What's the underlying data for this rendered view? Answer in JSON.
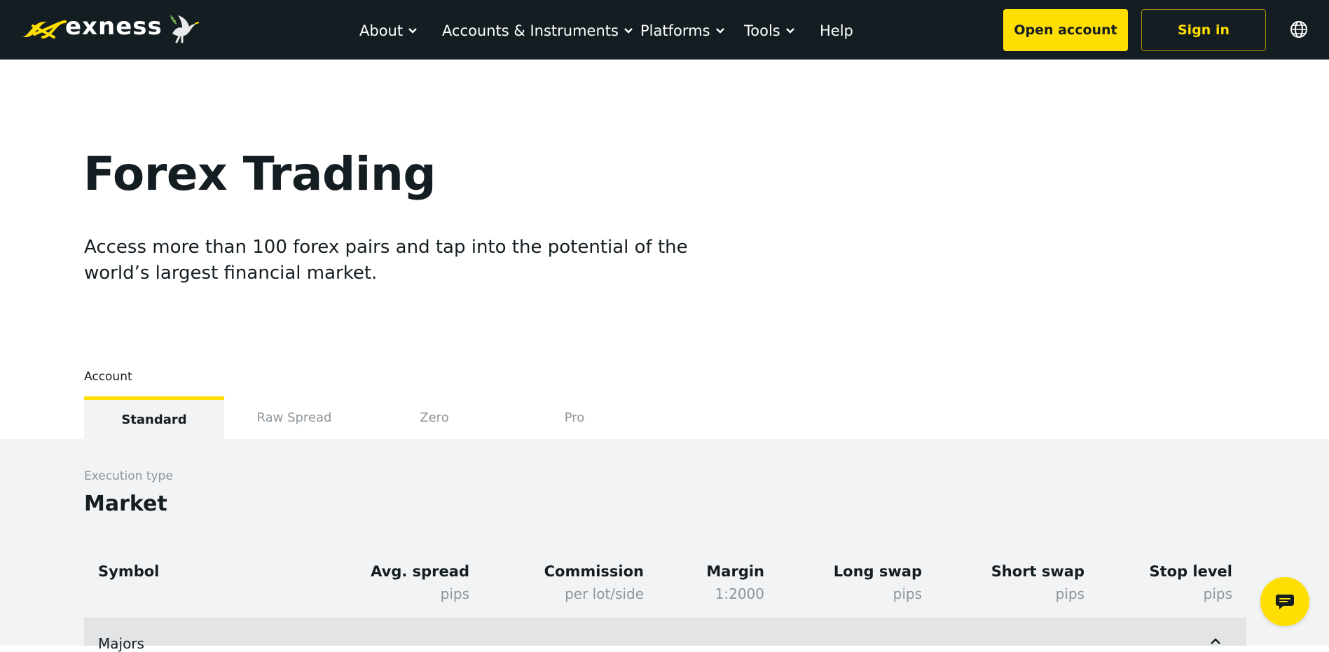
{
  "header": {
    "logo_text": "exness",
    "nav": [
      {
        "label": "About",
        "has_dropdown": true
      },
      {
        "label": "Accounts & Instruments",
        "has_dropdown": true
      },
      {
        "label": "Platforms",
        "has_dropdown": true
      },
      {
        "label": "Tools",
        "has_dropdown": true
      },
      {
        "label": "Help",
        "has_dropdown": false
      }
    ],
    "open_account_label": "Open account",
    "sign_in_label": "Sign in",
    "language_icon": "globe-icon"
  },
  "hero": {
    "title": "Forex Trading",
    "subtitle": "Access more than 100 forex pairs and tap into the potential of the world’s largest financial market."
  },
  "account": {
    "label": "Account",
    "tabs": [
      "Standard",
      "Raw Spread",
      "Zero",
      "Pro"
    ],
    "active_tab": "Standard"
  },
  "execution": {
    "label": "Execution type",
    "value": "Market"
  },
  "table": {
    "columns": [
      {
        "header": "Symbol",
        "sub": ""
      },
      {
        "header": "Avg. spread",
        "sub": "pips"
      },
      {
        "header": "Commission",
        "sub": "per lot/side"
      },
      {
        "header": "Margin",
        "sub": "1:2000"
      },
      {
        "header": "Long swap",
        "sub": "pips"
      },
      {
        "header": "Short swap",
        "sub": "pips"
      },
      {
        "header": "Stop level",
        "sub": "pips"
      }
    ],
    "groups": [
      {
        "label": "Majors",
        "expanded": true
      }
    ]
  },
  "colors": {
    "header_bg": "#141d22",
    "accent_yellow": "#ffde02",
    "section_bg": "#f2f3f4",
    "muted_text": "#8e959a"
  },
  "chat_icon": "chat-bubble-icon"
}
